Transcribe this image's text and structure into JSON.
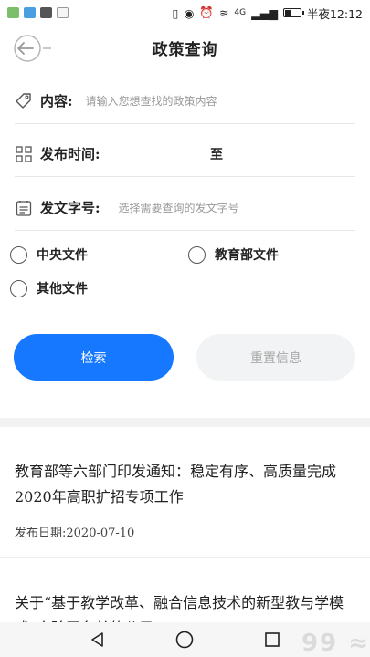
{
  "status_bar": {
    "time_label": "半夜12:12",
    "network_label": "4G"
  },
  "header": {
    "title": "政策查询"
  },
  "form": {
    "content_label": "内容:",
    "content_placeholder": "请输入您想查找的政策内容",
    "time_label": "发布时间:",
    "time_separator": "至",
    "doc_no_label": "发文字号:",
    "doc_no_placeholder": "选择需要查询的发文字号"
  },
  "filters": [
    {
      "label": "中央文件",
      "checked": false
    },
    {
      "label": "教育部文件",
      "checked": false
    },
    {
      "label": "其他文件",
      "checked": false
    }
  ],
  "buttons": {
    "search_label": "检索",
    "reset_label": "重置信息"
  },
  "results": [
    {
      "title": "教育部等六部门印发通知：稳定有序、高质量完成2020年高职扩招专项工作",
      "date": "发布日期:2020-07-10"
    },
    {
      "title": "关于“基于教学改革、融合信息技术的新型教与学模式”实验区名单的公示"
    }
  ],
  "colors": {
    "accent": "#1677ff",
    "reset_bg": "#f2f3f5"
  }
}
